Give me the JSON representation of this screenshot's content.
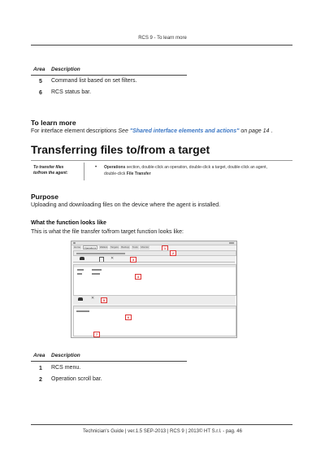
{
  "header": {
    "title": "RCS 9 - To learn more"
  },
  "table1": {
    "col_area": "Area",
    "col_desc": "Description",
    "rows": [
      {
        "area": "5",
        "desc": "Command list based on set filters."
      },
      {
        "area": "6",
        "desc": "RCS status bar."
      }
    ]
  },
  "learn_more": {
    "heading": "To learn more",
    "text_prefix": "For interface element descriptions ",
    "see": "See ",
    "link": "\"Shared interface elements and actions\"",
    "on_page": " on page 14",
    "suffix": " ."
  },
  "section": {
    "title": "Transferring files to/from a target"
  },
  "howto": {
    "label_line1": "To transfer files",
    "label_line2": "to/from the agent:",
    "bullet": "•",
    "operations": "Operations",
    "text_line1_rest": " section, double-click an operation, double-click a target, double-click an agent,",
    "text_line2_prefix": "double-click ",
    "file_transfer": "File Transfer"
  },
  "purpose": {
    "heading": "Purpose",
    "text": "Uploading and downloading files on the device where the agent is installed."
  },
  "looks": {
    "heading": "What the function looks like",
    "text": "This is what the file transfer to/from target function looks like:"
  },
  "screenshot": {
    "tabs": [
      "Home",
      "Operations",
      "Wallets",
      "Targets",
      "Backup",
      "Tools",
      "Monitor"
    ],
    "callouts": [
      "1",
      "2",
      "3",
      "4",
      "5",
      "6",
      "7"
    ]
  },
  "table2": {
    "col_area": "Area",
    "col_desc": "Description",
    "rows": [
      {
        "area": "1",
        "desc": "RCS menu."
      },
      {
        "area": "2",
        "desc": "Operation scroll bar."
      }
    ]
  },
  "footer": {
    "text": "Technician's Guide | ver.1.5 SEP-2013 | RCS 9 | 2013© HT S.r.l. - pag. 46"
  }
}
